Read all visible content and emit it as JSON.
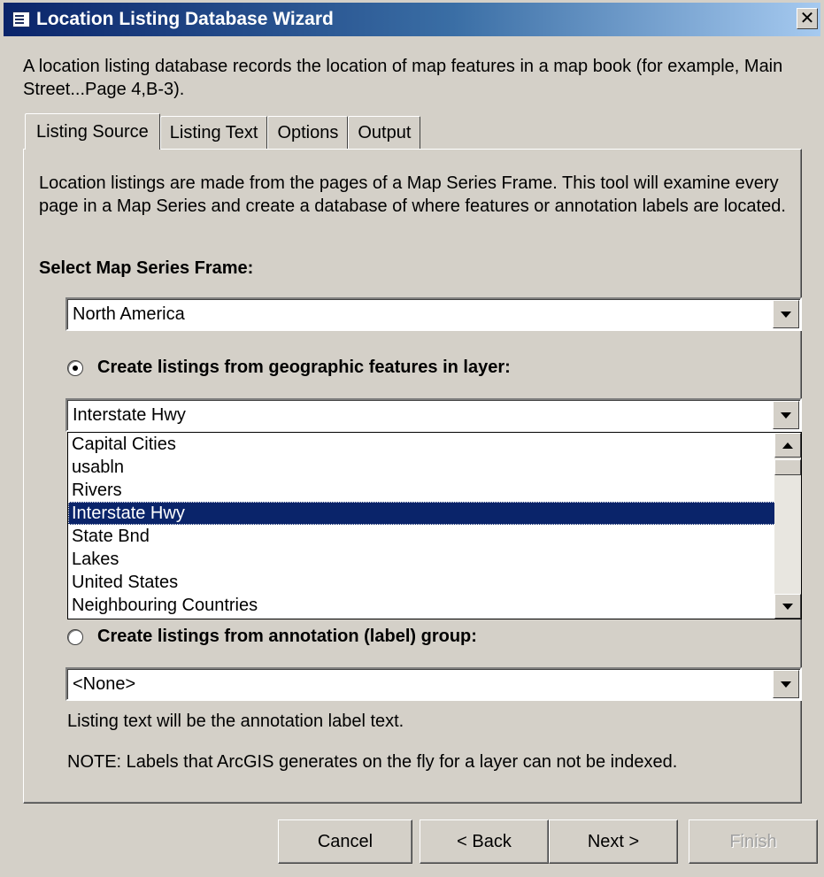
{
  "window": {
    "title": "Location Listing Database Wizard",
    "close_glyph": "✕"
  },
  "intro": "A location listing database records the location of map features in a map book (for example, Main Street...Page 4,B-3).",
  "tabs": [
    {
      "label": "Listing Source",
      "active": true
    },
    {
      "label": "Listing Text",
      "active": false
    },
    {
      "label": "Options",
      "active": false
    },
    {
      "label": "Output",
      "active": false
    }
  ],
  "panel": {
    "description": "Location listings are made from the pages of a Map Series Frame.  This tool will examine every page in a Map Series and create a database of where features or annotation labels are located.",
    "frame_label": "Select Map Series Frame:",
    "frame_value": "North America",
    "radio_features": {
      "label": "Create listings from geographic features in layer:",
      "selected": true
    },
    "layer_value": "Interstate Hwy",
    "layer_options": [
      "Capital Cities",
      "usabln",
      "Rivers",
      "Interstate Hwy",
      "State Bnd",
      "Lakes",
      "United States",
      "Neighbouring Countries"
    ],
    "layer_selected_index": 3,
    "radio_annotation": {
      "label": "Create listings from annotation (label) group:",
      "selected": false
    },
    "annotation_value": "<None>",
    "annotation_hint": "Listing text will be the annotation label text.",
    "note": "NOTE: Labels that ArcGIS generates on the fly for a layer can not be indexed."
  },
  "buttons": {
    "cancel": "Cancel",
    "back": "< Back",
    "next": "Next >",
    "finish": "Finish"
  },
  "colors": {
    "title_start": "#0a246a",
    "title_end": "#a6caf0",
    "face": "#d4d0c8",
    "selection": "#0a246a"
  }
}
